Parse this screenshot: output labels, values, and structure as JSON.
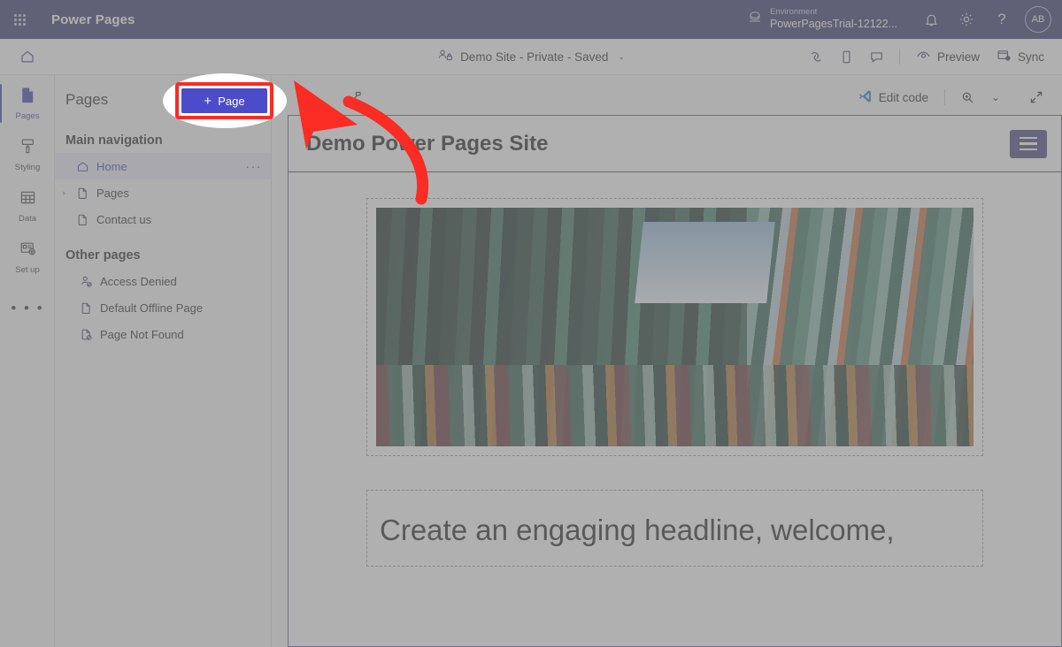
{
  "suite": {
    "waffle_icon": "app-launcher-icon",
    "title": "Power Pages",
    "environment_label": "Environment",
    "environment_value": "PowerPagesTrial-12122...",
    "globe_icon": "environment-globe-icon",
    "notification_icon": "bell-icon",
    "settings_icon": "gear-icon",
    "help_icon": "question-mark-icon",
    "help_glyph": "?",
    "avatar_initials": "AB"
  },
  "command_bar": {
    "home_icon": "home-icon",
    "site_status": "Demo Site - Private - Saved",
    "site_icon": "site-visibility-icon",
    "chevron": "⌄",
    "icons": [
      {
        "name": "pages-copilot-icon"
      },
      {
        "name": "mobile-preview-icon"
      },
      {
        "name": "feedback-comment-icon"
      }
    ],
    "preview_label": "Preview",
    "preview_icon": "eye-preview-icon",
    "sync_label": "Sync",
    "sync_icon": "sync-icon"
  },
  "rail": {
    "items": [
      {
        "label": "Pages",
        "icon": "pages-icon",
        "active": true
      },
      {
        "label": "Styling",
        "icon": "paint-roller-icon",
        "active": false
      },
      {
        "label": "Data",
        "icon": "table-data-icon",
        "active": false
      },
      {
        "label": "Set up",
        "icon": "setup-gear-icon",
        "active": false
      }
    ],
    "more_label": "• • •",
    "more_name": "rail-more-icon"
  },
  "panel": {
    "title": "Pages",
    "add_page_label": "Page",
    "add_page_plus": "+",
    "main_navigation_title": "Main navigation",
    "other_pages_title": "Other pages",
    "main_navigation": [
      {
        "label": "Home",
        "icon": "home-page-icon",
        "selected": true,
        "expandable": false,
        "overflow": "···"
      },
      {
        "label": "Pages",
        "icon": "page-icon",
        "selected": false,
        "expandable": true,
        "chevron": "›"
      },
      {
        "label": "Contact us",
        "icon": "page-icon",
        "selected": false,
        "expandable": false
      }
    ],
    "other_pages": [
      {
        "label": "Access Denied",
        "icon": "access-denied-icon"
      },
      {
        "label": "Default Offline Page",
        "icon": "page-icon"
      },
      {
        "label": "Page Not Found",
        "icon": "page-not-found-icon"
      }
    ]
  },
  "canvas_toolbar": {
    "left_icon": "components-tree-icon",
    "edit_code_label": "Edit code",
    "edit_code_icon": "vscode-icon",
    "zoom_icon": "magnifier-zoom-icon",
    "zoom_chevron": "⌄",
    "expand_icon": "expand-arrows-icon"
  },
  "site_preview": {
    "brand": "Demo Power Pages Site",
    "menu_icon": "hamburger-menu-icon",
    "hero_image_alt": "colorful-containers-image",
    "headline": "Create an engaging headline, welcome,"
  },
  "annotations": {
    "highlight_shape": "red-rectangle-highlight",
    "spotlight_shape": "white-ellipse-spotlight",
    "arrow_shape": "curved-red-arrow",
    "target": "add-page-button",
    "colors": {
      "highlight": "#fa2c23",
      "arrow": "#fa2c23",
      "accent": "#4c4ccb",
      "suite_bar": "#2e2e66"
    }
  }
}
